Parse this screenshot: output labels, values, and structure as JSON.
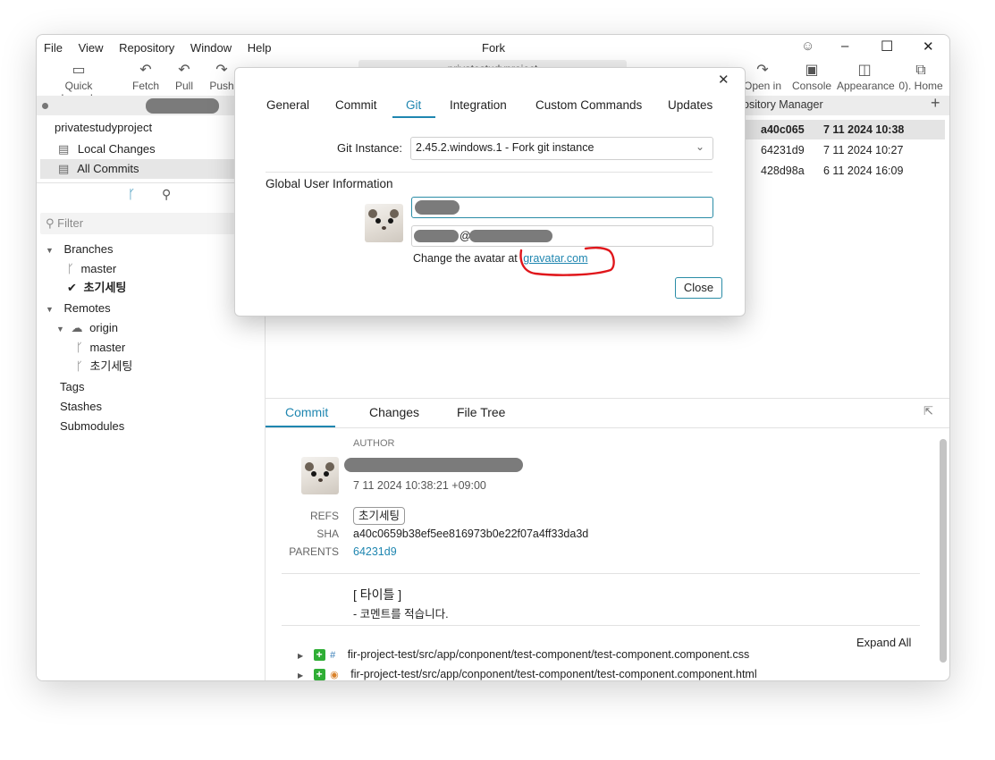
{
  "window": {
    "title": "Fork",
    "controls": {
      "smiley": "☺",
      "minimize": "–",
      "maximize": "☐",
      "close": "✕"
    }
  },
  "menu": [
    "File",
    "View",
    "Repository",
    "Window",
    "Help"
  ],
  "toolbar": {
    "quick_launch": "Quick Launch",
    "fetch": "Fetch",
    "pull": "Pull",
    "push": "Push",
    "open_in": "Open in",
    "console": "Console",
    "appearance": "Appearance",
    "home": "0). Home",
    "repo_title": "privatestudyproject"
  },
  "sidebar": {
    "repo_name": "privatestudyproject",
    "local_changes": "Local Changes",
    "all_commits": "All Commits",
    "filter_placeholder": "Filter",
    "branches": "Branches",
    "branch_master": "master",
    "branch_current": "초기세팅",
    "remotes": "Remotes",
    "origin": "origin",
    "remote_master": "master",
    "remote_branch": "초기세팅",
    "tags": "Tags",
    "stashes": "Stashes",
    "submodules": "Submodules"
  },
  "repo_manager": {
    "label": "ository Manager"
  },
  "commits": [
    {
      "sha": "a40c065",
      "date": "7 11 2024 10:38"
    },
    {
      "sha": "64231d9",
      "date": "7 11 2024 10:27"
    },
    {
      "sha": "428d98a",
      "date": "6 11 2024 16:09"
    }
  ],
  "details": {
    "tabs": [
      "Commit",
      "Changes",
      "File Tree"
    ],
    "author_label": "AUTHOR",
    "author_date": "7 11 2024 10:38:21 +09:00",
    "refs_label": "REFS",
    "refs_value": "초기세팅",
    "sha_label": "SHA",
    "sha_value": "a40c0659b38ef5ee816973b0e22f07a4ff33da3d",
    "parents_label": "PARENTS",
    "parents_value": "64231d9",
    "message_title": "[ 타이틀 ]",
    "message_body": "- 코멘트를 적습니다.",
    "expand_all": "Expand All",
    "files": [
      "fir-project-test/src/app/conponent/test-component/test-component.component.css",
      "fir-project-test/src/app/conponent/test-component/test-component.component.html"
    ]
  },
  "dialog": {
    "tabs": [
      "General",
      "Commit",
      "Git",
      "Integration",
      "Custom Commands",
      "Updates"
    ],
    "active_tab": "Git",
    "git_instance_label": "Git Instance:",
    "git_instance_value": "2.45.2.windows.1 - Fork git instance",
    "section_title": "Global User Information",
    "email_visible": "@",
    "avatar_text": "Change the avatar at",
    "avatar_link": "gravatar.com",
    "close_button": "Close",
    "close_x": "✕"
  },
  "colors": {
    "accent": "#1f86b0",
    "annotation": "#e0161b"
  }
}
